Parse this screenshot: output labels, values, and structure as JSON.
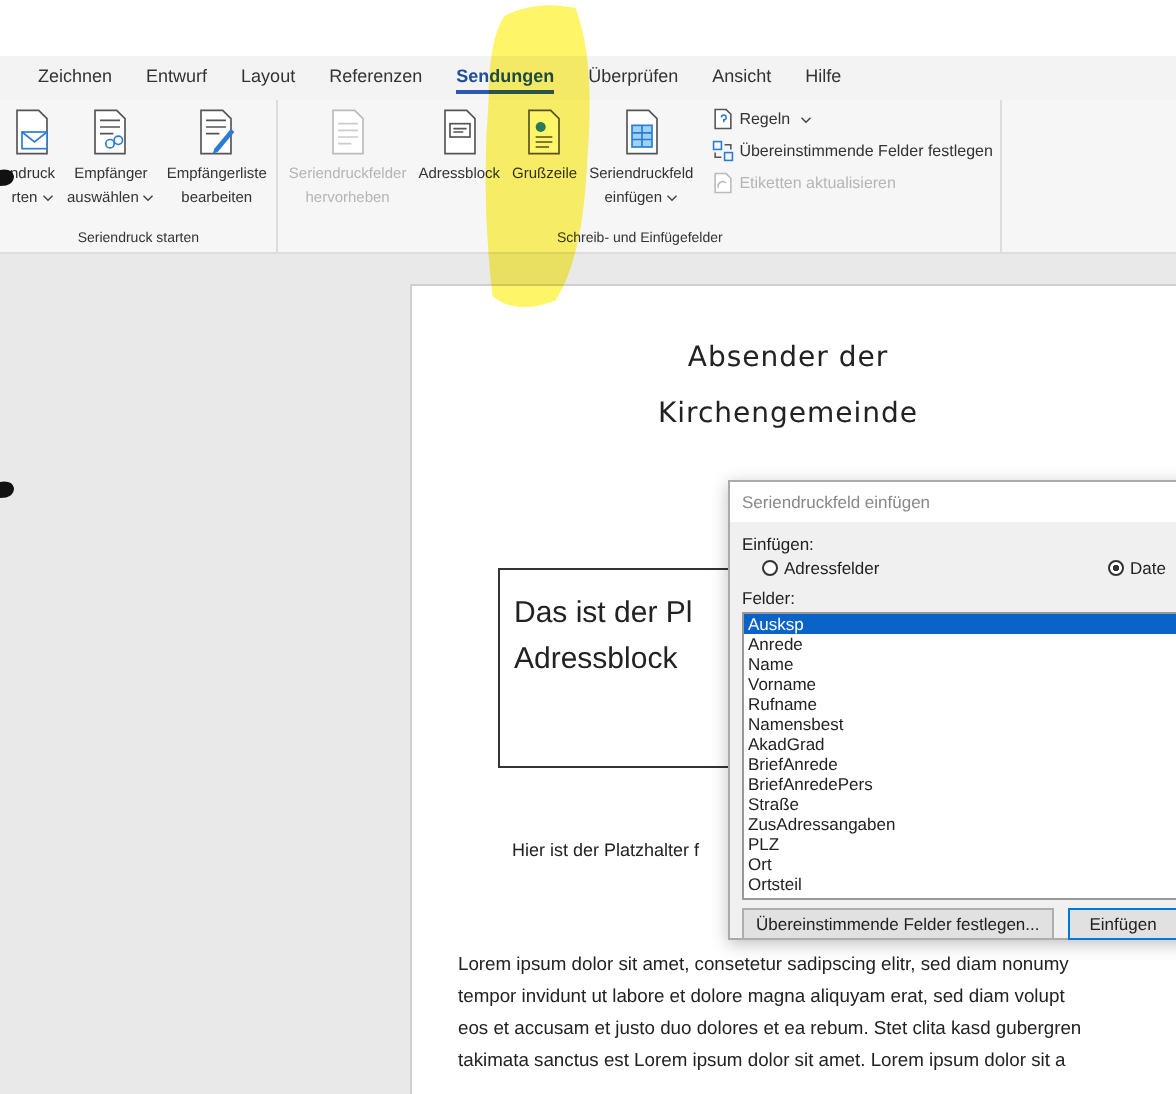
{
  "tabs": [
    {
      "label": "Zeichnen",
      "selected": false
    },
    {
      "label": "Entwurf",
      "selected": false
    },
    {
      "label": "Layout",
      "selected": false
    },
    {
      "label": "Referenzen",
      "selected": false
    },
    {
      "label": "Sendungen",
      "selected": true
    },
    {
      "label": "Überprüfen",
      "selected": false
    },
    {
      "label": "Ansicht",
      "selected": false
    },
    {
      "label": "Hilfe",
      "selected": false
    }
  ],
  "ribbon": {
    "groups": [
      {
        "label": "Seriendruck starten",
        "buttons": [
          {
            "lines": [
              "ndruck",
              "rten"
            ],
            "dropdown": true,
            "disabled": false,
            "kind": "envelope"
          },
          {
            "lines": [
              "Empfänger",
              "auswählen"
            ],
            "dropdown": true,
            "disabled": false,
            "kind": "recipients"
          },
          {
            "lines": [
              "Empfängerliste",
              "bearbeiten"
            ],
            "dropdown": false,
            "disabled": false,
            "kind": "editlist"
          }
        ]
      },
      {
        "label": "Schreib- und Einfügefelder",
        "buttons": [
          {
            "lines": [
              "Seriendruckfelder",
              "hervorheben"
            ],
            "dropdown": false,
            "disabled": true,
            "kind": "document"
          },
          {
            "lines": [
              "Adressblock"
            ],
            "dropdown": false,
            "disabled": false,
            "kind": "address"
          },
          {
            "lines": [
              "Grußzeile"
            ],
            "dropdown": false,
            "disabled": false,
            "kind": "greeting"
          },
          {
            "lines": [
              "Seriendruckfeld",
              "einfügen"
            ],
            "dropdown": true,
            "disabled": false,
            "kind": "field"
          }
        ],
        "small_buttons": [
          {
            "label": "Regeln",
            "dropdown": true,
            "disabled": false,
            "kind": "rules"
          },
          {
            "label": "Übereinstimmende Felder festlegen",
            "dropdown": false,
            "disabled": false,
            "kind": "match"
          },
          {
            "label": "Etiketten aktualisieren",
            "dropdown": false,
            "disabled": true,
            "kind": "refresh"
          }
        ]
      }
    ]
  },
  "document": {
    "heading_lines": [
      "Absender der",
      "Kirchengemeinde"
    ],
    "address_box_lines": [
      "Das ist der Pl",
      "Adressblock"
    ],
    "note": "Hier ist der Platzhalter f",
    "body_lines": [
      "Lorem ipsum dolor sit amet, consetetur sadipscing elitr, sed diam nonumy",
      "tempor invidunt ut labore et dolore magna aliquyam erat, sed diam volupt",
      "eos et accusam et justo duo dolores et ea rebum. Stet clita kasd gubergren",
      "takimata sanctus est Lorem ipsum dolor sit amet. Lorem ipsum dolor sit a"
    ]
  },
  "dialog": {
    "title": "Seriendruckfeld einfügen",
    "insert_label": "Einfügen:",
    "options": [
      {
        "label": "Adressfelder",
        "selected": false
      },
      {
        "label": "Date",
        "selected": true
      }
    ],
    "fields_label": "Felder:",
    "fields": [
      {
        "label": "Ausksp",
        "selected": true
      },
      {
        "label": "Anrede",
        "selected": false
      },
      {
        "label": "Name",
        "selected": false
      },
      {
        "label": "Vorname",
        "selected": false
      },
      {
        "label": "Rufname",
        "selected": false
      },
      {
        "label": "Namensbest",
        "selected": false
      },
      {
        "label": "AkadGrad",
        "selected": false
      },
      {
        "label": "BriefAnrede",
        "selected": false
      },
      {
        "label": "BriefAnredePers",
        "selected": false
      },
      {
        "label": "Straße",
        "selected": false
      },
      {
        "label": "ZusAdressangaben",
        "selected": false
      },
      {
        "label": "PLZ",
        "selected": false
      },
      {
        "label": "Ort",
        "selected": false
      },
      {
        "label": "Ortsteil",
        "selected": false
      }
    ],
    "buttons": [
      {
        "label": "Übereinstimmende Felder festlegen...",
        "default": false
      },
      {
        "label": "Einfügen",
        "default": true
      }
    ]
  }
}
